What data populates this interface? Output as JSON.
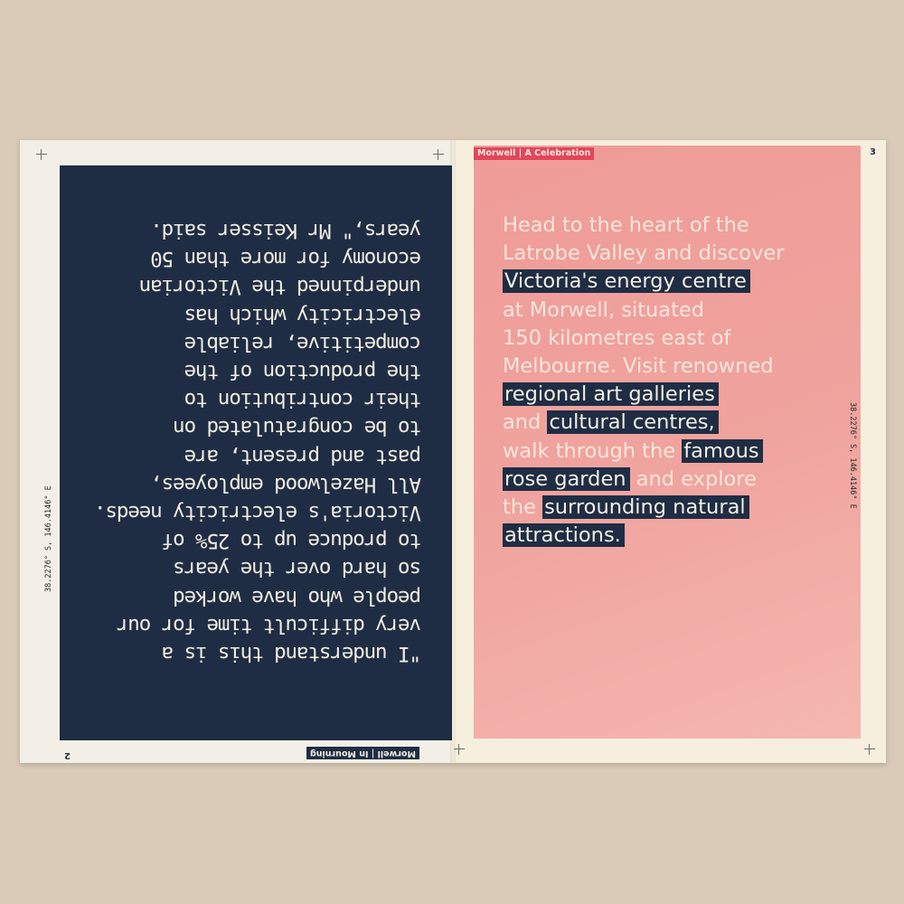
{
  "left_page": {
    "section_label": "Morwell | In Mourning",
    "page_number": "2",
    "coordinates": "38.2276° S, 146.4146° E",
    "orientation": "upside-down",
    "panel_color": "#1f2d44",
    "quote_lines": [
      "\"I understand this is a",
      "very difficult time for our",
      "people who have worked",
      "so hard over the years",
      "to produce up to 25% of",
      "Victoria's electricity needs.",
      "All Hazelwood employees,",
      "past and present, are",
      "to be congratulated on",
      "their contribution to",
      "the production of the",
      "competitive, reliable",
      "electricity which has",
      "underpinned the Victorian",
      "economy for more than 50",
      "years,\" Mr Keisser said."
    ]
  },
  "right_page": {
    "section_label": "Morwell | A Celebration",
    "page_number": "3",
    "coordinates": "38.2276° S, 146.4146° E",
    "panel_color": "#ef9b97",
    "label_color": "#e0475a",
    "highlight_color": "#1f2d44",
    "paragraph_lines": [
      [
        {
          "text": "Head to the heart of the",
          "hl": false
        }
      ],
      [
        {
          "text": "Latrobe Valley and discover",
          "hl": false
        }
      ],
      [
        {
          "text": "Victoria's energy centre",
          "hl": true
        }
      ],
      [
        {
          "text": "at Morwell, situated",
          "hl": false
        }
      ],
      [
        {
          "text": "150 kilometres east of",
          "hl": false
        }
      ],
      [
        {
          "text": "Melbourne. Visit renowned",
          "hl": false
        }
      ],
      [
        {
          "text": "regional art galleries",
          "hl": true
        }
      ],
      [
        {
          "text": "and ",
          "hl": false
        },
        {
          "text": "cultural centres,",
          "hl": true
        }
      ],
      [
        {
          "text": "walk through the ",
          "hl": false
        },
        {
          "text": "famous",
          "hl": true
        }
      ],
      [
        {
          "text": "rose garden",
          "hl": true
        },
        {
          "text": " and explore",
          "hl": false
        }
      ],
      [
        {
          "text": "the ",
          "hl": false
        },
        {
          "text": "surrounding natural",
          "hl": true
        }
      ],
      [
        {
          "text": "attractions.",
          "hl": true
        }
      ]
    ]
  }
}
